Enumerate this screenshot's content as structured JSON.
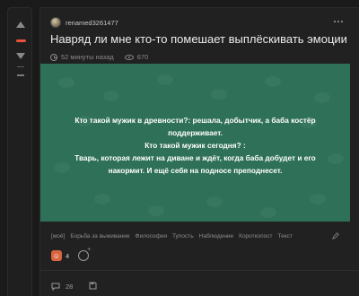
{
  "post": {
    "author": "renamed3261477",
    "title": "Навряд ли мне кто-то помешает выплёскивать эмоции",
    "time_ago": "52 минуты назад",
    "views": "670",
    "image_text": {
      "line1": "Кто такой мужик в древности?: решала, добытчик, а баба костёр поддерживает.",
      "line2": "Кто такой мужик сегодня? :",
      "line3": "Тварь, которая лежит на диване и ждёт, когда баба добудет и его накормит. И ещё себя на подносе преподнесет."
    },
    "tags": [
      "[моё]",
      "Борьба за выживание",
      "Философия",
      "Тупость",
      "Наблюдение",
      "Короткопост",
      "Текст"
    ],
    "reactions": {
      "count": "4"
    },
    "comments_count": "28"
  },
  "colors": {
    "background": "#1a1a1a",
    "card": "#212121",
    "image_bg": "#2f7058",
    "rating_accent": "#e8533a",
    "reaction_accent": "#d9653f"
  }
}
